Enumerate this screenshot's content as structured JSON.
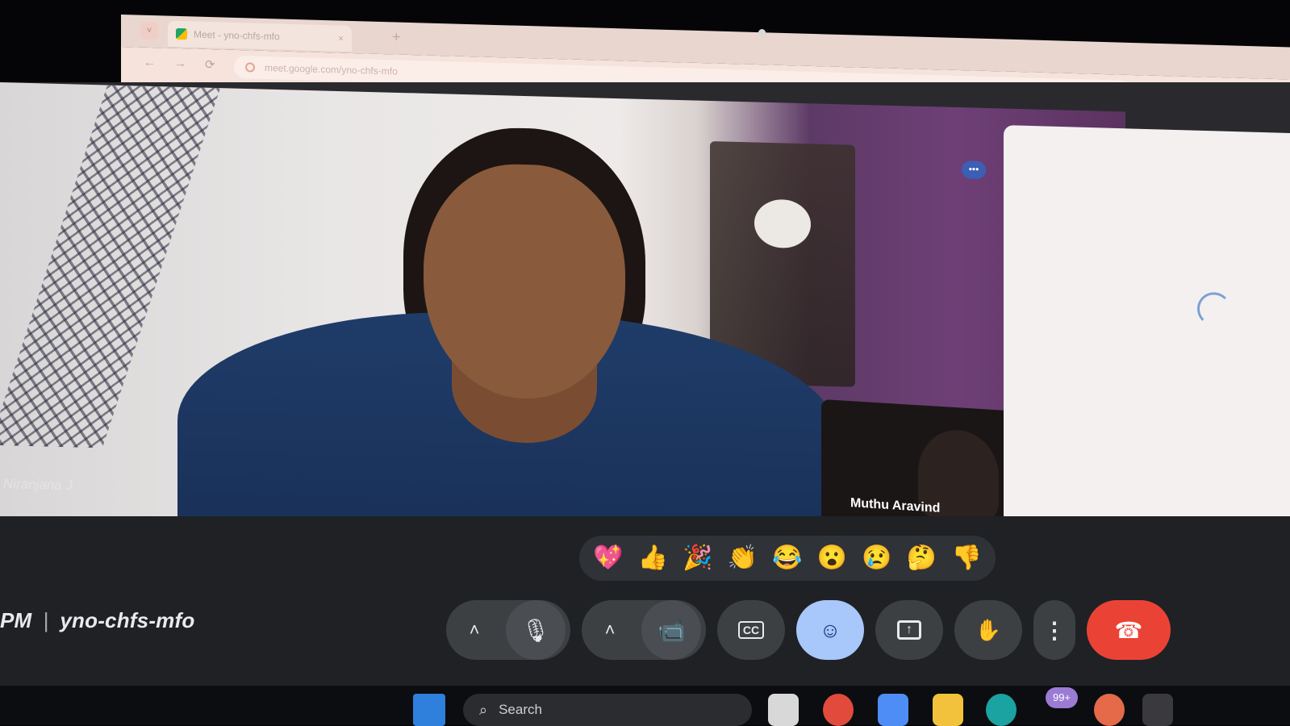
{
  "browser": {
    "tab_title": "Meet - yno-chfs-mfo",
    "tab_close": "×",
    "new_tab": "+",
    "tab_list": "˅",
    "url": "meet.google.com/yno-chfs-mfo",
    "back": "←",
    "forward": "→",
    "reload": "⟳",
    "star": "☆",
    "extensions": "□"
  },
  "meet": {
    "main_participant_name": "Niranjana J",
    "self_participant_name": "Muthu Aravind",
    "more_badge": "•••",
    "reactions": [
      {
        "emoji": "💖",
        "name": "sparkling-heart"
      },
      {
        "emoji": "👍",
        "name": "thumbs-up"
      },
      {
        "emoji": "🎉",
        "name": "party-popper"
      },
      {
        "emoji": "👏",
        "name": "clapping-hands"
      },
      {
        "emoji": "😂",
        "name": "tears-of-joy"
      },
      {
        "emoji": "😮",
        "name": "surprised-face"
      },
      {
        "emoji": "😢",
        "name": "crying-face"
      },
      {
        "emoji": "🤔",
        "name": "thinking-face"
      },
      {
        "emoji": "👎",
        "name": "thumbs-down"
      }
    ],
    "meeting_time": "PM",
    "meeting_separator": "|",
    "meeting_code": "yno-chfs-mfo",
    "controls": {
      "chevron": "˄",
      "mic": "🎙",
      "camera": "📹",
      "captions": "CC",
      "emoji": "☺",
      "present": "↑",
      "raise_hand": "✋",
      "more": "⋮",
      "leave": "☎"
    },
    "accent_color": "#a8c7fa",
    "leave_color": "#ea4335"
  },
  "taskbar": {
    "search_icon": "⌕",
    "search_text": "Search",
    "badge": "99+"
  }
}
